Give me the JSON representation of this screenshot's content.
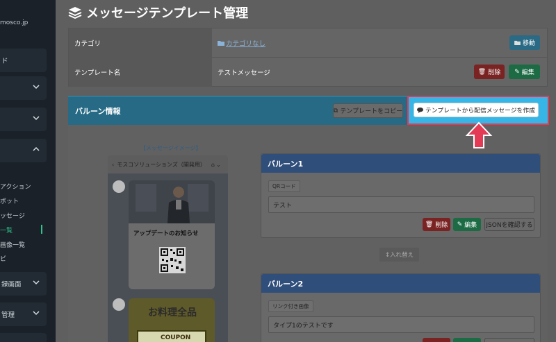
{
  "sidebar": {
    "user_suffix": "mosco.jp",
    "block_1": "ド",
    "subitems": [
      "アクション",
      "ボット",
      "ッセージ",
      "一覧",
      "画像一覧",
      "ビ"
    ],
    "block_bottom_1": "録画面",
    "block_bottom_2": "管理"
  },
  "page": {
    "title": "メッセージテンプレート管理"
  },
  "info": {
    "category_label": "カテゴリ",
    "category_value": "カテゴリなし",
    "move_button": "移動",
    "template_label": "テンプレート名",
    "template_value": "テストメッセージ",
    "delete_button": "削除",
    "edit_button": "編集"
  },
  "balloon_section": {
    "title": "バルーン情報",
    "copy_button": "テンプレートをコピー",
    "create_button": "テンプレートから配信メッセージを作成"
  },
  "preview": {
    "label": "【メッセージイメージ】",
    "header": "モスコソリューションズ（開発用）",
    "card_title": "アップデートのお知らせ",
    "card2_text": "お料理全品",
    "coupon_text": "COUPON"
  },
  "balloons": [
    {
      "title": "バルーン1",
      "type": "QRコード",
      "text": "テスト",
      "delete_button": "削除",
      "edit_button": "編集",
      "json_button": "JSONを確認する"
    },
    {
      "title": "バルーン2",
      "type": "リンク付き画像",
      "text": "タイプ1のテストです"
    }
  ],
  "swap_button": "↕入れ替え",
  "colors": {
    "highlight_border": "#e33a56",
    "highlight_fill": "#35b6e6",
    "arrow": "#e33a56"
  }
}
